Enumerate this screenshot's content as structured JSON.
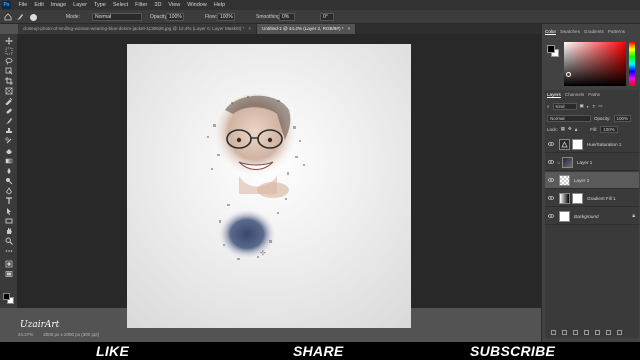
{
  "menubar": {
    "items": [
      "File",
      "Edit",
      "Image",
      "Layer",
      "Type",
      "Select",
      "Filter",
      "3D",
      "View",
      "Window",
      "Help"
    ]
  },
  "options": {
    "mode_label": "Mode:",
    "mode_value": "Normal",
    "opacity_label": "Opacity:",
    "opacity_value": "100%",
    "flow_label": "Flow:",
    "flow_value": "100%",
    "smoothing_label": "Smoothing:",
    "smoothing_value": "0%",
    "angle_value": "0°"
  },
  "tabs": [
    {
      "label": "closeup-photo-of-smiling-woman-wearing-blue-denim-jacket-1130626.jpg @ 12.4% (Layer 0, Layer Mask/8) *",
      "active": false
    },
    {
      "label": "Untitled-1 @ 44.4% (Layer 2, RGB/8#) *",
      "active": true
    }
  ],
  "status": {
    "zoom": "44.27%",
    "doc_size": "2000 px x 2000 px (300 ppi)"
  },
  "color_panel": {
    "tabs": [
      "Color",
      "Swatches",
      "Gradients",
      "Patterns"
    ]
  },
  "layers_panel": {
    "tabs": [
      "Layers",
      "Channels",
      "Paths"
    ],
    "filter_kind": "Kind",
    "blend_mode": "Normal",
    "opacity_label": "Opacity:",
    "opacity_value": "100%",
    "lock_label": "Lock:",
    "fill_label": "Fill:",
    "fill_value": "100%",
    "layers": [
      {
        "name": "Hue/Saturation 1",
        "thumb": "adj",
        "italic": false,
        "selected": false
      },
      {
        "name": "Layer 1",
        "thumb": "dark",
        "italic": false,
        "selected": false
      },
      {
        "name": "Layer 2",
        "thumb": "checker",
        "italic": false,
        "selected": true
      },
      {
        "name": "Gradient Fill 1",
        "thumb": "grad",
        "italic": false,
        "selected": false
      },
      {
        "name": "Background",
        "thumb": "white",
        "italic": true,
        "selected": false
      }
    ]
  },
  "banner": {
    "like": "LIKE",
    "share": "SHARE",
    "subscribe": "SUBSCRIBE"
  },
  "signature": "UzairArt"
}
